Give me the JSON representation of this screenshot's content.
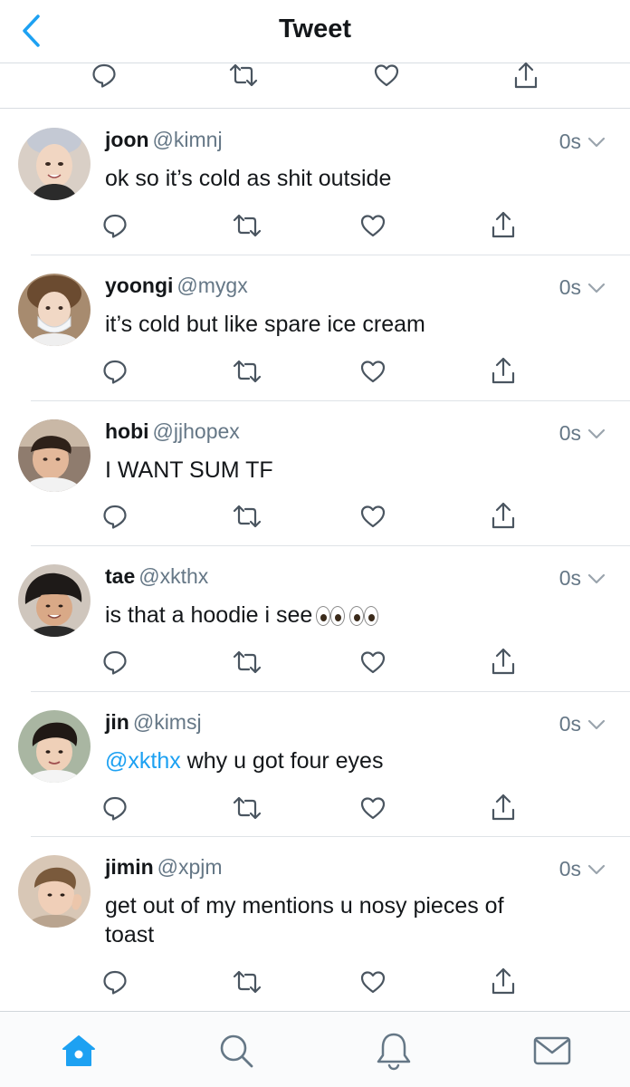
{
  "header": {
    "title": "Tweet",
    "back_icon": "chevron-left-icon"
  },
  "colors": {
    "accent": "#1da1f2",
    "text": "#14171a",
    "secondary": "#657786",
    "divider": "#dfe3e7"
  },
  "top_actions": {
    "icons": [
      "reply-icon",
      "retweet-icon",
      "like-icon",
      "share-icon"
    ]
  },
  "tweets": [
    {
      "name": "joon",
      "handle": "@kimnj",
      "time": "0s",
      "text": "ok so it’s cold as shit outside",
      "mention": ""
    },
    {
      "name": "yoongi",
      "handle": "@mygx",
      "time": "0s",
      "text": "it’s cold but like spare ice cream",
      "mention": ""
    },
    {
      "name": "hobi",
      "handle": "@jjhopex",
      "time": "0s",
      "text": "I WANT SUM TF",
      "mention": ""
    },
    {
      "name": "tae",
      "handle": "@xkthx",
      "time": "0s",
      "text": "is that a hoodie i see",
      "mention": "",
      "emoji": "eyes-emoji"
    },
    {
      "name": "jin",
      "handle": "@kimsj",
      "time": "0s",
      "text": " why u got four eyes",
      "mention": "@xkthx"
    },
    {
      "name": "jimin",
      "handle": "@xpjm",
      "time": "0s",
      "text": "get out of my mentions u nosy pieces of toast",
      "mention": ""
    }
  ],
  "bottom_nav": {
    "items": [
      "home-icon",
      "search-icon",
      "notifications-icon",
      "messages-icon"
    ],
    "active": "home-icon"
  }
}
